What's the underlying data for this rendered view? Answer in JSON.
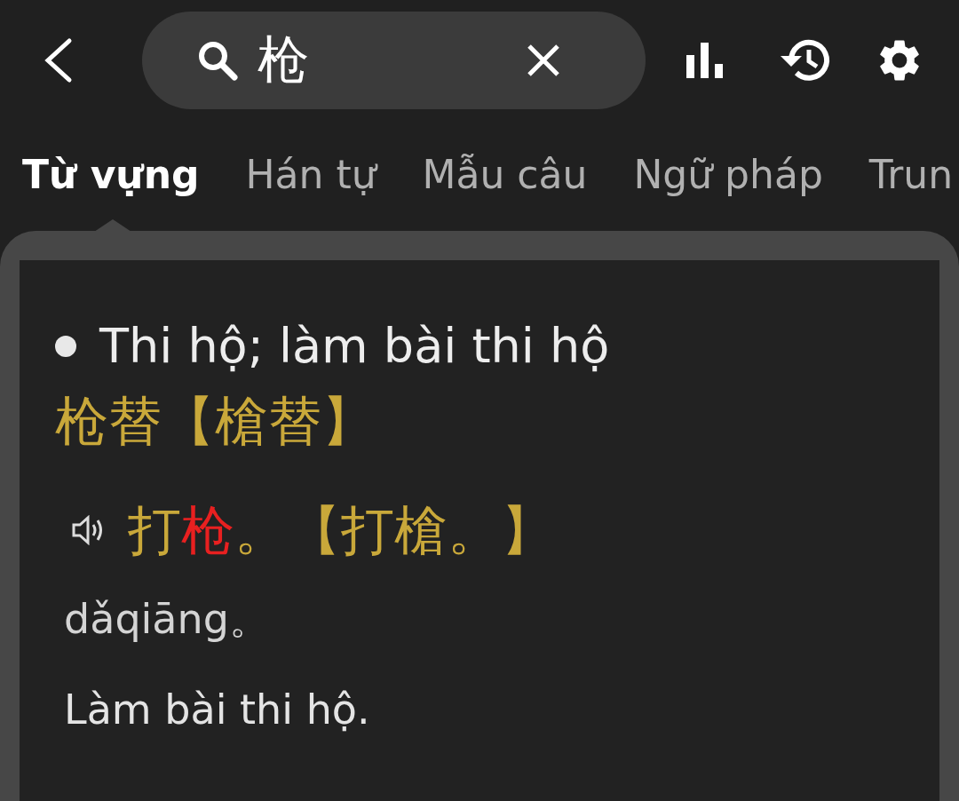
{
  "search": {
    "value": "枪"
  },
  "tabs": [
    {
      "label": "Từ vựng",
      "selected": true
    },
    {
      "label": "Hán tự",
      "selected": false
    },
    {
      "label": "Mẫu câu",
      "selected": false
    },
    {
      "label": "Ngữ pháp",
      "selected": false
    },
    {
      "label": "Trun",
      "selected": false
    }
  ],
  "entry": {
    "meaning": "Thi hộ; làm bài thi hộ",
    "word": "枪替【槍替】",
    "example": {
      "segments": [
        {
          "text": "打",
          "highlight": false
        },
        {
          "text": "枪",
          "highlight": true
        },
        {
          "text": "。【打槍。】",
          "highlight": false
        }
      ],
      "pinyin": "dǎqiāng。",
      "translation": "Làm bài thi hộ."
    }
  }
}
